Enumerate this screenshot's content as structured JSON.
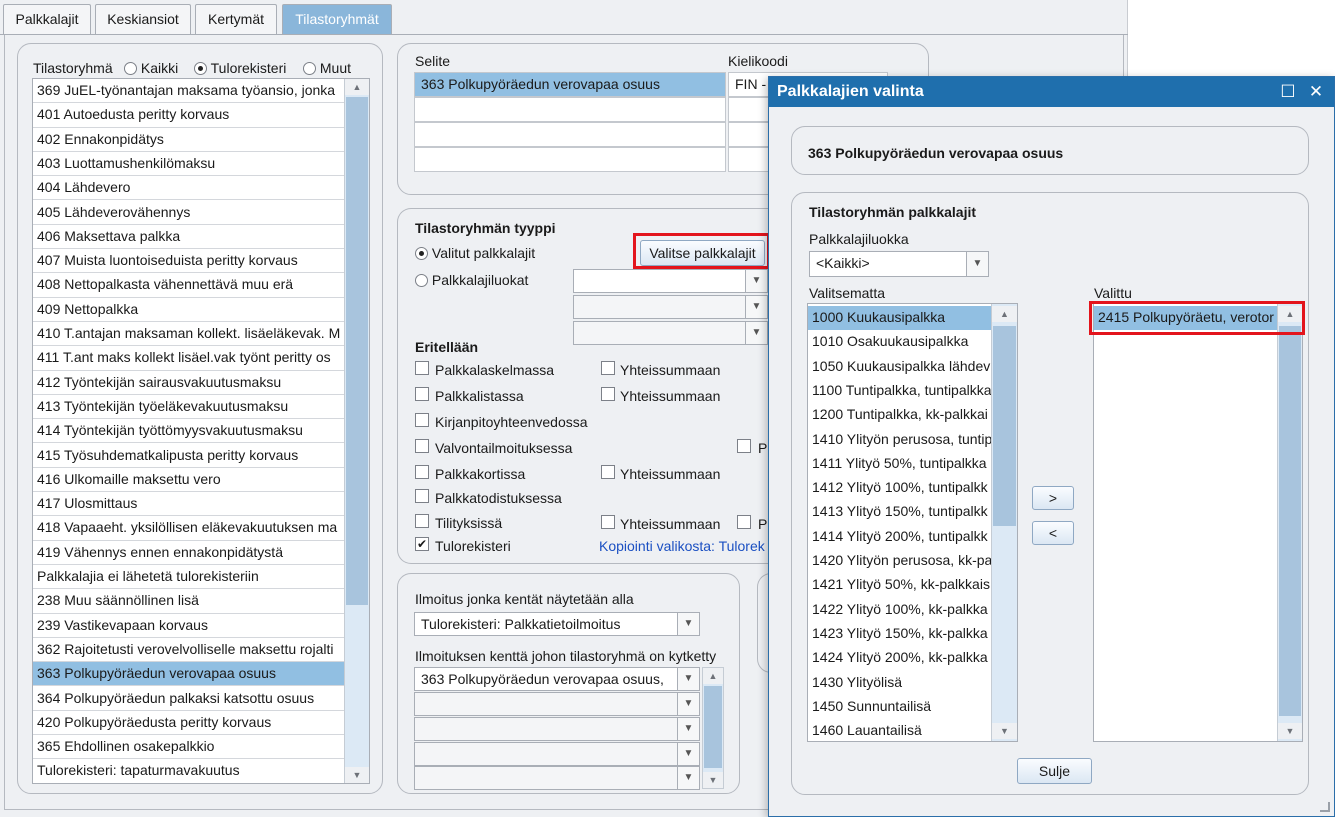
{
  "tabs": [
    "Palkkalajit",
    "Keskiansiot",
    "Kertymät",
    "Tilastoryhmät"
  ],
  "filter": {
    "label": "Tilastoryhmä",
    "options": [
      "Kaikki",
      "Tulorekisteri",
      "Muut"
    ]
  },
  "groups": [
    "369 JuEL-työnantajan maksama työansio, jonka",
    "401 Autoedusta peritty korvaus",
    "402 Ennakonpidätys",
    "403 Luottamushenkilömaksu",
    "404 Lähdevero",
    "405 Lähdeverovähennys",
    "406 Maksettava palkka",
    "407 Muista luontoiseduista peritty korvaus",
    "408 Nettopalkasta vähennettävä muu erä",
    "409 Nettopalkka",
    "410 T.antajan maksaman kollekt. lisäeläkevak. M",
    "411 T.ant maks kollekt lisäel.vak työnt peritty os",
    "412 Työntekijän sairausvakuutusmaksu",
    "413 Työntekijän työeläkevakuutusmaksu",
    "414 Työntekijän työttömyysvakuutusmaksu",
    "415 Työsuhdematkalipusta peritty korvaus",
    "416 Ulkomaille maksettu vero",
    "417 Ulosmittaus",
    "418 Vapaaeht. yksilöllisen eläkevakuutuksen ma",
    "419 Vähennys ennen ennakonpidätystä",
    "Palkkalajia ei lähetetä tulorekisteriin",
    "238 Muu säännöllinen lisä",
    "239 Vastikevapaan korvaus",
    "362 Rajoitetusti verovelvolliselle maksettu rojalti",
    "363 Polkupyöräedun verovapaa osuus",
    "364 Polkupyöräedun palkaksi katsottu osuus",
    "420 Polkupyöräedusta peritty korvaus",
    "365 Ehdollinen osakepalkkio",
    "Tulorekisteri: tapaturmavakuutus"
  ],
  "desc": {
    "col_selite": "Selite",
    "col_kielikoodi": "Kielikoodi",
    "row_text": "363 Polkupyöräedun verovapaa osuus",
    "row_lang": "FIN - "
  },
  "type_section": {
    "title": "Tilastoryhmän tyyppi",
    "radio_selected": "Valitut palkkalajit",
    "radio_classes": "Palkkalajiluokat",
    "choose_button": "Valitse palkkalajit",
    "eritellaan": "Eritellään",
    "checks": [
      "Palkkalaskelmassa",
      "Palkkalistassa",
      "Kirjanpitoyhteenvedossa",
      "Valvontailmoituksessa",
      "Palkkakortissa",
      "Palkkatodistuksessa",
      "Tilityksissä",
      "Tulorekisteri"
    ],
    "sum": "Yhteissummaan",
    "p_fragment": "P",
    "copy_link": "Kopiointi valikosta: Tulorek"
  },
  "report": {
    "label1": "Ilmoitus jonka kentät näytetään alla",
    "combo1": "Tulorekisteri: Palkkatietoilmoitus",
    "label2": "Ilmoituksen kenttä johon tilastoryhmä on kytketty",
    "combo2": "363 Polkupyöräedun verovapaa osuus,"
  },
  "dialog": {
    "title": "Palkkalajien valinta",
    "header": "363 Polkupyöräedun verovapaa osuus",
    "section": "Tilastoryhmän palkkalajit",
    "class_label": "Palkkalajiluokka",
    "class_value": "<Kaikki>",
    "unselected_label": "Valitsematta",
    "selected_label": "Valittu",
    "unselected": [
      "1000 Kuukausipalkka",
      "1010 Osakuukausipalkka",
      "1050 Kuukausipalkka lähdev",
      "1100 Tuntipalkka, tuntipalkka",
      "1200 Tuntipalkka, kk-palkkai",
      "1410 Ylityön perusosa, tuntip",
      "1411 Ylityö 50%, tuntipalkka",
      "1412 Ylityö 100%, tuntipalkk",
      "1413 Ylityö 150%, tuntipalkk",
      "1414 Ylityö 200%, tuntipalkk",
      "1420 Ylityön perusosa, kk-pal",
      "1421 Ylityö 50%, kk-palkkais",
      "1422 Ylityö 100%, kk-palkka",
      "1423 Ylityö 150%, kk-palkka",
      "1424 Ylityö 200%, kk-palkka",
      "1430 Ylityölisä",
      "1450 Sunnuntailisä",
      "1460 Lauantailisä"
    ],
    "selected": [
      "2415 Polkupyöräetu, verotor"
    ],
    "add_button": ">",
    "remove_button": "<",
    "close_button": "Sulje"
  }
}
